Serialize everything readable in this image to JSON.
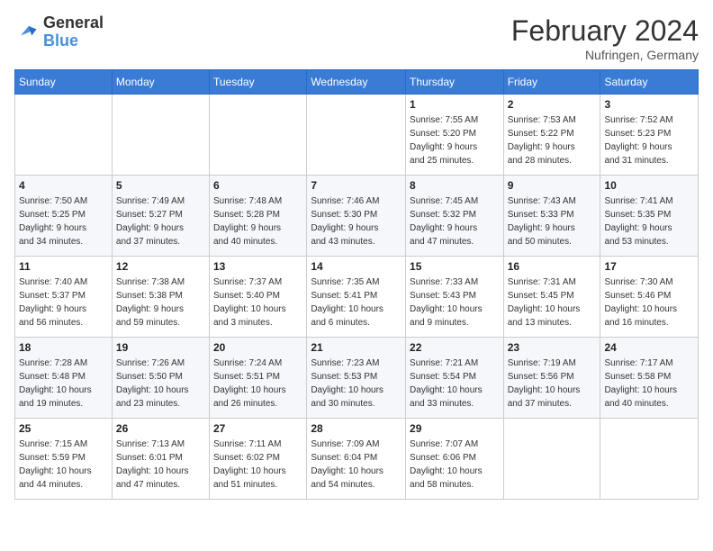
{
  "header": {
    "logo_text_general": "General",
    "logo_text_blue": "Blue",
    "month_year": "February 2024",
    "location": "Nufringen, Germany"
  },
  "weekdays": [
    "Sunday",
    "Monday",
    "Tuesday",
    "Wednesday",
    "Thursday",
    "Friday",
    "Saturday"
  ],
  "weeks": [
    [
      {
        "day": "",
        "info": ""
      },
      {
        "day": "",
        "info": ""
      },
      {
        "day": "",
        "info": ""
      },
      {
        "day": "",
        "info": ""
      },
      {
        "day": "1",
        "info": "Sunrise: 7:55 AM\nSunset: 5:20 PM\nDaylight: 9 hours\nand 25 minutes."
      },
      {
        "day": "2",
        "info": "Sunrise: 7:53 AM\nSunset: 5:22 PM\nDaylight: 9 hours\nand 28 minutes."
      },
      {
        "day": "3",
        "info": "Sunrise: 7:52 AM\nSunset: 5:23 PM\nDaylight: 9 hours\nand 31 minutes."
      }
    ],
    [
      {
        "day": "4",
        "info": "Sunrise: 7:50 AM\nSunset: 5:25 PM\nDaylight: 9 hours\nand 34 minutes."
      },
      {
        "day": "5",
        "info": "Sunrise: 7:49 AM\nSunset: 5:27 PM\nDaylight: 9 hours\nand 37 minutes."
      },
      {
        "day": "6",
        "info": "Sunrise: 7:48 AM\nSunset: 5:28 PM\nDaylight: 9 hours\nand 40 minutes."
      },
      {
        "day": "7",
        "info": "Sunrise: 7:46 AM\nSunset: 5:30 PM\nDaylight: 9 hours\nand 43 minutes."
      },
      {
        "day": "8",
        "info": "Sunrise: 7:45 AM\nSunset: 5:32 PM\nDaylight: 9 hours\nand 47 minutes."
      },
      {
        "day": "9",
        "info": "Sunrise: 7:43 AM\nSunset: 5:33 PM\nDaylight: 9 hours\nand 50 minutes."
      },
      {
        "day": "10",
        "info": "Sunrise: 7:41 AM\nSunset: 5:35 PM\nDaylight: 9 hours\nand 53 minutes."
      }
    ],
    [
      {
        "day": "11",
        "info": "Sunrise: 7:40 AM\nSunset: 5:37 PM\nDaylight: 9 hours\nand 56 minutes."
      },
      {
        "day": "12",
        "info": "Sunrise: 7:38 AM\nSunset: 5:38 PM\nDaylight: 9 hours\nand 59 minutes."
      },
      {
        "day": "13",
        "info": "Sunrise: 7:37 AM\nSunset: 5:40 PM\nDaylight: 10 hours\nand 3 minutes."
      },
      {
        "day": "14",
        "info": "Sunrise: 7:35 AM\nSunset: 5:41 PM\nDaylight: 10 hours\nand 6 minutes."
      },
      {
        "day": "15",
        "info": "Sunrise: 7:33 AM\nSunset: 5:43 PM\nDaylight: 10 hours\nand 9 minutes."
      },
      {
        "day": "16",
        "info": "Sunrise: 7:31 AM\nSunset: 5:45 PM\nDaylight: 10 hours\nand 13 minutes."
      },
      {
        "day": "17",
        "info": "Sunrise: 7:30 AM\nSunset: 5:46 PM\nDaylight: 10 hours\nand 16 minutes."
      }
    ],
    [
      {
        "day": "18",
        "info": "Sunrise: 7:28 AM\nSunset: 5:48 PM\nDaylight: 10 hours\nand 19 minutes."
      },
      {
        "day": "19",
        "info": "Sunrise: 7:26 AM\nSunset: 5:50 PM\nDaylight: 10 hours\nand 23 minutes."
      },
      {
        "day": "20",
        "info": "Sunrise: 7:24 AM\nSunset: 5:51 PM\nDaylight: 10 hours\nand 26 minutes."
      },
      {
        "day": "21",
        "info": "Sunrise: 7:23 AM\nSunset: 5:53 PM\nDaylight: 10 hours\nand 30 minutes."
      },
      {
        "day": "22",
        "info": "Sunrise: 7:21 AM\nSunset: 5:54 PM\nDaylight: 10 hours\nand 33 minutes."
      },
      {
        "day": "23",
        "info": "Sunrise: 7:19 AM\nSunset: 5:56 PM\nDaylight: 10 hours\nand 37 minutes."
      },
      {
        "day": "24",
        "info": "Sunrise: 7:17 AM\nSunset: 5:58 PM\nDaylight: 10 hours\nand 40 minutes."
      }
    ],
    [
      {
        "day": "25",
        "info": "Sunrise: 7:15 AM\nSunset: 5:59 PM\nDaylight: 10 hours\nand 44 minutes."
      },
      {
        "day": "26",
        "info": "Sunrise: 7:13 AM\nSunset: 6:01 PM\nDaylight: 10 hours\nand 47 minutes."
      },
      {
        "day": "27",
        "info": "Sunrise: 7:11 AM\nSunset: 6:02 PM\nDaylight: 10 hours\nand 51 minutes."
      },
      {
        "day": "28",
        "info": "Sunrise: 7:09 AM\nSunset: 6:04 PM\nDaylight: 10 hours\nand 54 minutes."
      },
      {
        "day": "29",
        "info": "Sunrise: 7:07 AM\nSunset: 6:06 PM\nDaylight: 10 hours\nand 58 minutes."
      },
      {
        "day": "",
        "info": ""
      },
      {
        "day": "",
        "info": ""
      }
    ]
  ]
}
